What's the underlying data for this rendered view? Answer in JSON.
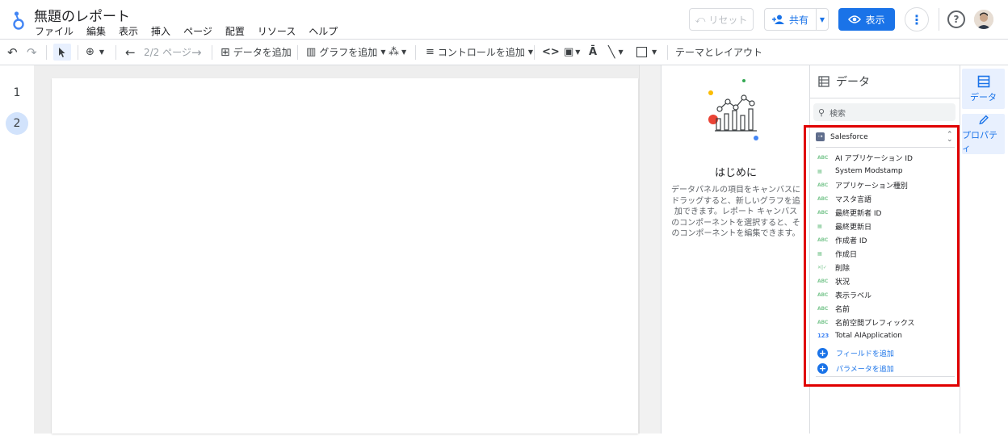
{
  "app": {
    "title": "無題のレポート",
    "menu": [
      "ファイル",
      "編集",
      "表示",
      "挿入",
      "ページ",
      "配置",
      "リソース",
      "ヘルプ"
    ]
  },
  "header": {
    "reset_label": "リセット",
    "share_label": "共有",
    "view_label": "表示"
  },
  "toolbar": {
    "page_nav": "2/2 ページ",
    "add_data": "データを追加",
    "add_chart": "グラフを追加",
    "add_control": "コントロールを追加",
    "theme_layout": "テーマとレイアウト"
  },
  "pages": [
    "1",
    "2"
  ],
  "intro": {
    "title": "はじめに",
    "text": "データパネルの項目をキャンバスにドラッグすると、新しいグラフを追加できます。レポート キャンバスのコンポーネントを選択すると、そのコンポーネントを編集できます。"
  },
  "data_panel": {
    "title": "データ",
    "search_placeholder": "検索",
    "source_name": "Salesforce",
    "fields": [
      {
        "type": "ABC",
        "name": "AI アプリケーション ID"
      },
      {
        "type": "date",
        "name": "System Modstamp"
      },
      {
        "type": "ABC",
        "name": "アプリケーション種別"
      },
      {
        "type": "ABC",
        "name": "マスタ言語"
      },
      {
        "type": "ABC",
        "name": "最終更新者 ID"
      },
      {
        "type": "date",
        "name": "最終更新日"
      },
      {
        "type": "ABC",
        "name": "作成者 ID"
      },
      {
        "type": "date",
        "name": "作成日"
      },
      {
        "type": "bool",
        "name": "削除"
      },
      {
        "type": "ABC",
        "name": "状況"
      },
      {
        "type": "ABC",
        "name": "表示ラベル"
      },
      {
        "type": "ABC",
        "name": "名前"
      },
      {
        "type": "ABC",
        "name": "名前空間プレフィックス"
      },
      {
        "type": "123",
        "name": "Total AIApplication"
      }
    ],
    "add_field": "フィールドを追加",
    "add_parameter": "パラメータを追加"
  },
  "rail": {
    "data_label": "データ",
    "properties_label": "プロパティ"
  },
  "colors": {
    "accent": "#1a73e8",
    "highlight": "#e00000",
    "selected_page": "#d2e3fc"
  }
}
